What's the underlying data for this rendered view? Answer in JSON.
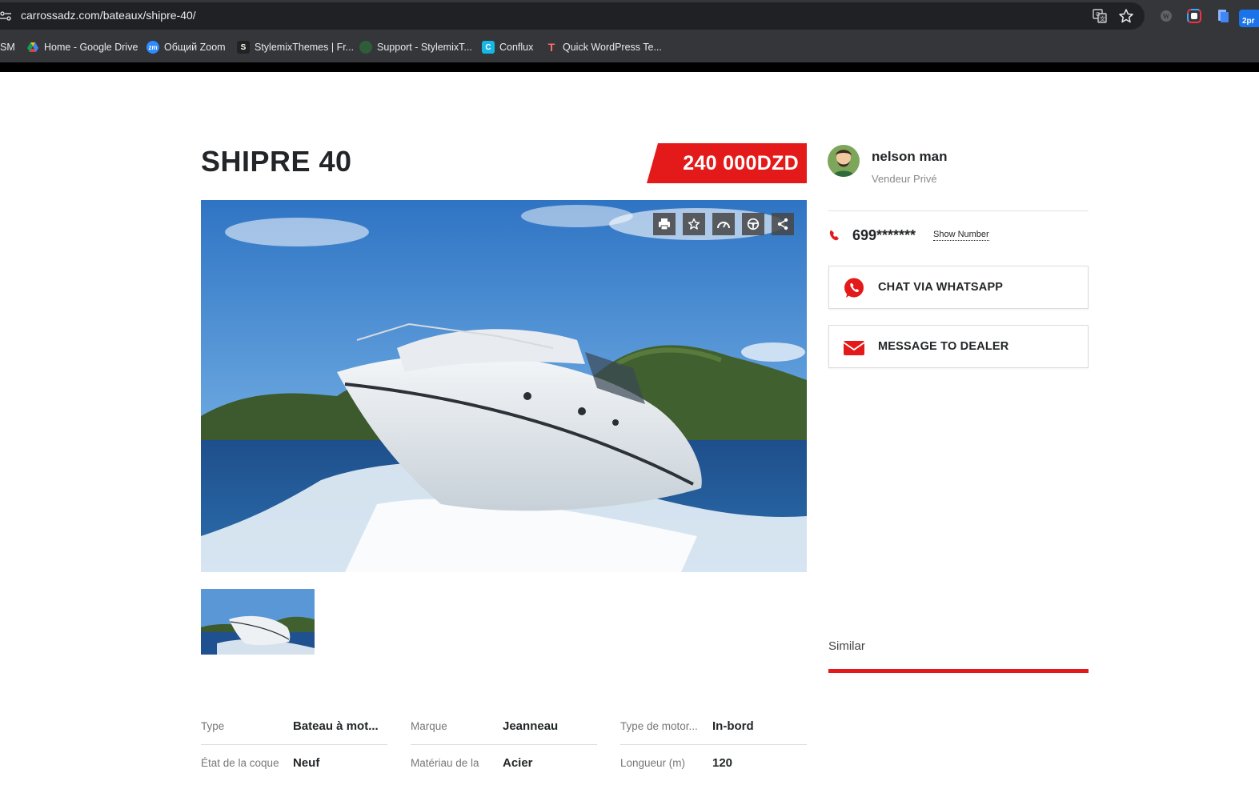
{
  "browser": {
    "url": "carrossadz.com/bateaux/shipre-40/",
    "bookmarks": [
      {
        "label": "SM"
      },
      {
        "label": "Home - Google Drive"
      },
      {
        "label": "Общий Zoom"
      },
      {
        "label": "StylemixThemes | Fr..."
      },
      {
        "label": "Support - StylemixT..."
      },
      {
        "label": "Conflux"
      },
      {
        "label": "Quick WordPress Te..."
      }
    ],
    "ext_badge": "2pr"
  },
  "listing": {
    "title": "SHIPRE 40",
    "price": "240 000DZD",
    "image_subject": "white motor yacht speeding on blue sea",
    "tools": [
      "print-icon",
      "star-icon",
      "speedometer-icon",
      "steering-wheel-icon",
      "share-icon"
    ]
  },
  "specs": [
    {
      "label": "Type",
      "value": "Bateau à mot..."
    },
    {
      "label": "Marque",
      "value": "Jeanneau"
    },
    {
      "label": "Type de motor...",
      "value": "In-bord"
    },
    {
      "label": "État de la coque",
      "value": "Neuf"
    },
    {
      "label": "Matériau de la",
      "value": "Acier"
    },
    {
      "label": "Longueur (m)",
      "value": "120"
    }
  ],
  "dealer": {
    "name": "nelson man",
    "type": "Vendeur Privé",
    "phone": "699*******",
    "show_number": "Show Number",
    "whatsapp_label": "CHAT VIA WHATSAPP",
    "message_label": "MESSAGE TO DEALER"
  },
  "similar": {
    "label": "Similar"
  },
  "colors": {
    "accent": "#e41a1a",
    "text": "#232628"
  }
}
